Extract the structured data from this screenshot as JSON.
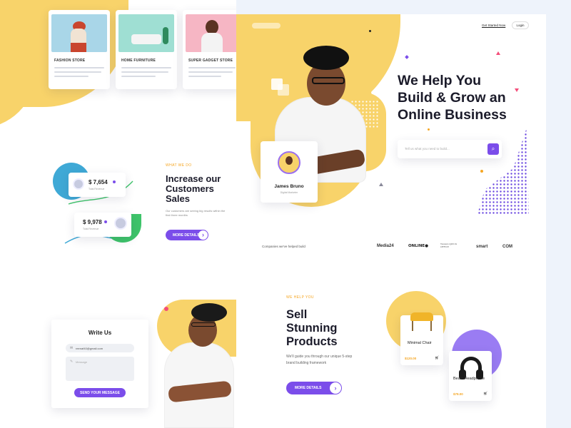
{
  "stores": [
    {
      "title": "FASHION STORE"
    },
    {
      "title": "HOME FURNITURE"
    },
    {
      "title": "SUPER GADGET STORE"
    }
  ],
  "stats": {
    "eyebrow": "WHAT WE DO",
    "heading": [
      "Increase our",
      "Customers",
      "Sales"
    ],
    "desc": "Our customers are seeing big results within the first three months",
    "value_1": "$ 7,654",
    "value_1_sub": "Total Revenue",
    "value_2": "$ 9,978",
    "value_2_sub": "Total Revenue",
    "button": "MORE DETAILS"
  },
  "contact": {
    "title": "Write Us",
    "email_value": "reenaf40@gmail.com",
    "message_placeholder": "Message",
    "button": "SEND YOUR MESSAGE"
  },
  "header": {
    "get_started": "Get Started Now",
    "login": "Login"
  },
  "hero": {
    "title": [
      "We Help You",
      "Build & Grow an",
      "Online Business"
    ],
    "search_placeholder": "Tell us what you need to build...",
    "profile_name": "James Bruno",
    "profile_role": "Digital Marketer"
  },
  "companies": {
    "label": "Companies we've helped build",
    "logos": [
      "Media24",
      "ONLINE●",
      "Western QUICK OFFICE",
      "smart",
      "COM"
    ]
  },
  "products_section": {
    "eyebrow": "WE HELP YOU",
    "heading": [
      "Sell",
      "Stunning",
      "Products"
    ],
    "desc": [
      "We'll guide you through our unique 5-step",
      "brand building framework"
    ],
    "button": "MORE DETAILS",
    "items": [
      {
        "name": "Minimal Chair",
        "price": "$120.00"
      },
      {
        "name": "Beats Headphone",
        "price": "$79.00"
      }
    ]
  },
  "colors": {
    "accent": "#7b4dea",
    "yellow": "#f8d36a",
    "price": "#f5a623"
  }
}
